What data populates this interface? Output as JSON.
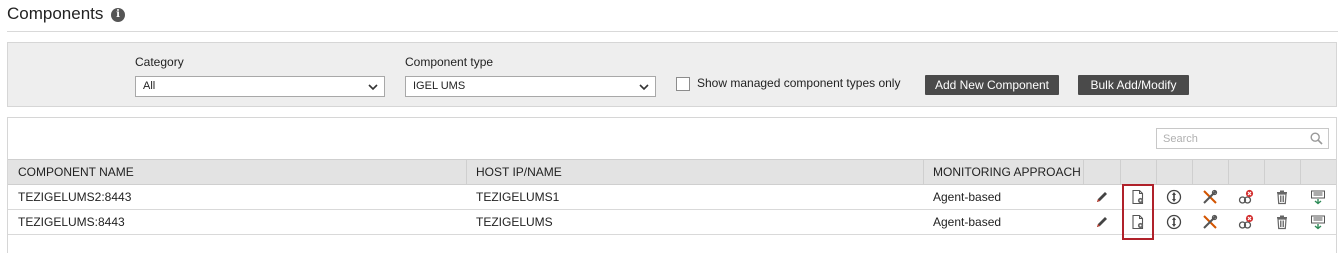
{
  "page": {
    "title": "Components"
  },
  "filters": {
    "category_label": "Category",
    "category_value": "All",
    "component_type_label": "Component type",
    "component_type_value": "IGEL UMS",
    "show_managed_label": "Show managed component types only",
    "add_new_label": "Add New Component",
    "bulk_label": "Bulk Add/Modify"
  },
  "search": {
    "placeholder": "Search"
  },
  "table": {
    "columns": [
      "COMPONENT NAME",
      "HOST IP/NAME",
      "MONITORING APPROACH"
    ],
    "rows": [
      {
        "name": "TEZIGELUMS2:8443",
        "host": "TEZIGELUMS1",
        "approach": "Agent-based"
      },
      {
        "name": "TEZIGELUMS:8443",
        "host": "TEZIGELUMS",
        "approach": "Agent-based"
      }
    ],
    "action_icons": [
      "edit-icon",
      "config-document-icon",
      "manage-icon",
      "tools-icon",
      "unmanage-icon",
      "delete-icon",
      "ip-change-icon"
    ]
  },
  "colors": {
    "button_bg": "#4a4a4a",
    "highlight": "#b0212a",
    "header_bg": "#e3e3e3",
    "panel_bg": "#eeeeee"
  }
}
